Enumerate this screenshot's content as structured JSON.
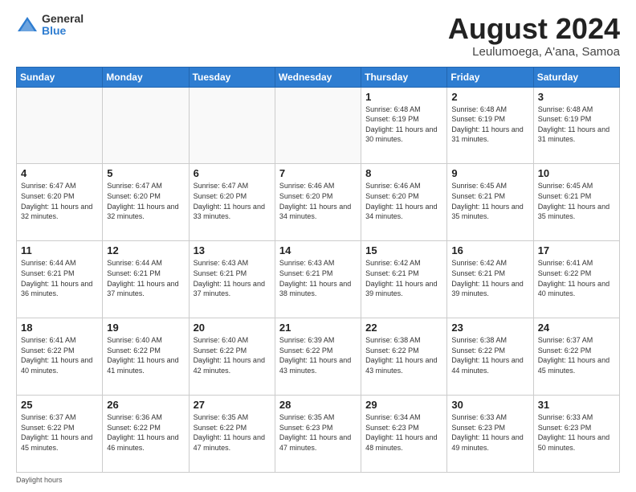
{
  "header": {
    "logo_general": "General",
    "logo_blue": "Blue",
    "title": "August 2024",
    "location": "Leulumoega, A'ana, Samoa"
  },
  "days_of_week": [
    "Sunday",
    "Monday",
    "Tuesday",
    "Wednesday",
    "Thursday",
    "Friday",
    "Saturday"
  ],
  "footer": {
    "note": "Daylight hours"
  },
  "weeks": [
    [
      {
        "day": "",
        "info": ""
      },
      {
        "day": "",
        "info": ""
      },
      {
        "day": "",
        "info": ""
      },
      {
        "day": "",
        "info": ""
      },
      {
        "day": "1",
        "info": "Sunrise: 6:48 AM\nSunset: 6:19 PM\nDaylight: 11 hours\nand 30 minutes."
      },
      {
        "day": "2",
        "info": "Sunrise: 6:48 AM\nSunset: 6:19 PM\nDaylight: 11 hours\nand 31 minutes."
      },
      {
        "day": "3",
        "info": "Sunrise: 6:48 AM\nSunset: 6:19 PM\nDaylight: 11 hours\nand 31 minutes."
      }
    ],
    [
      {
        "day": "4",
        "info": "Sunrise: 6:47 AM\nSunset: 6:20 PM\nDaylight: 11 hours\nand 32 minutes."
      },
      {
        "day": "5",
        "info": "Sunrise: 6:47 AM\nSunset: 6:20 PM\nDaylight: 11 hours\nand 32 minutes."
      },
      {
        "day": "6",
        "info": "Sunrise: 6:47 AM\nSunset: 6:20 PM\nDaylight: 11 hours\nand 33 minutes."
      },
      {
        "day": "7",
        "info": "Sunrise: 6:46 AM\nSunset: 6:20 PM\nDaylight: 11 hours\nand 34 minutes."
      },
      {
        "day": "8",
        "info": "Sunrise: 6:46 AM\nSunset: 6:20 PM\nDaylight: 11 hours\nand 34 minutes."
      },
      {
        "day": "9",
        "info": "Sunrise: 6:45 AM\nSunset: 6:21 PM\nDaylight: 11 hours\nand 35 minutes."
      },
      {
        "day": "10",
        "info": "Sunrise: 6:45 AM\nSunset: 6:21 PM\nDaylight: 11 hours\nand 35 minutes."
      }
    ],
    [
      {
        "day": "11",
        "info": "Sunrise: 6:44 AM\nSunset: 6:21 PM\nDaylight: 11 hours\nand 36 minutes."
      },
      {
        "day": "12",
        "info": "Sunrise: 6:44 AM\nSunset: 6:21 PM\nDaylight: 11 hours\nand 37 minutes."
      },
      {
        "day": "13",
        "info": "Sunrise: 6:43 AM\nSunset: 6:21 PM\nDaylight: 11 hours\nand 37 minutes."
      },
      {
        "day": "14",
        "info": "Sunrise: 6:43 AM\nSunset: 6:21 PM\nDaylight: 11 hours\nand 38 minutes."
      },
      {
        "day": "15",
        "info": "Sunrise: 6:42 AM\nSunset: 6:21 PM\nDaylight: 11 hours\nand 39 minutes."
      },
      {
        "day": "16",
        "info": "Sunrise: 6:42 AM\nSunset: 6:21 PM\nDaylight: 11 hours\nand 39 minutes."
      },
      {
        "day": "17",
        "info": "Sunrise: 6:41 AM\nSunset: 6:22 PM\nDaylight: 11 hours\nand 40 minutes."
      }
    ],
    [
      {
        "day": "18",
        "info": "Sunrise: 6:41 AM\nSunset: 6:22 PM\nDaylight: 11 hours\nand 40 minutes."
      },
      {
        "day": "19",
        "info": "Sunrise: 6:40 AM\nSunset: 6:22 PM\nDaylight: 11 hours\nand 41 minutes."
      },
      {
        "day": "20",
        "info": "Sunrise: 6:40 AM\nSunset: 6:22 PM\nDaylight: 11 hours\nand 42 minutes."
      },
      {
        "day": "21",
        "info": "Sunrise: 6:39 AM\nSunset: 6:22 PM\nDaylight: 11 hours\nand 43 minutes."
      },
      {
        "day": "22",
        "info": "Sunrise: 6:38 AM\nSunset: 6:22 PM\nDaylight: 11 hours\nand 43 minutes."
      },
      {
        "day": "23",
        "info": "Sunrise: 6:38 AM\nSunset: 6:22 PM\nDaylight: 11 hours\nand 44 minutes."
      },
      {
        "day": "24",
        "info": "Sunrise: 6:37 AM\nSunset: 6:22 PM\nDaylight: 11 hours\nand 45 minutes."
      }
    ],
    [
      {
        "day": "25",
        "info": "Sunrise: 6:37 AM\nSunset: 6:22 PM\nDaylight: 11 hours\nand 45 minutes."
      },
      {
        "day": "26",
        "info": "Sunrise: 6:36 AM\nSunset: 6:22 PM\nDaylight: 11 hours\nand 46 minutes."
      },
      {
        "day": "27",
        "info": "Sunrise: 6:35 AM\nSunset: 6:22 PM\nDaylight: 11 hours\nand 47 minutes."
      },
      {
        "day": "28",
        "info": "Sunrise: 6:35 AM\nSunset: 6:23 PM\nDaylight: 11 hours\nand 47 minutes."
      },
      {
        "day": "29",
        "info": "Sunrise: 6:34 AM\nSunset: 6:23 PM\nDaylight: 11 hours\nand 48 minutes."
      },
      {
        "day": "30",
        "info": "Sunrise: 6:33 AM\nSunset: 6:23 PM\nDaylight: 11 hours\nand 49 minutes."
      },
      {
        "day": "31",
        "info": "Sunrise: 6:33 AM\nSunset: 6:23 PM\nDaylight: 11 hours\nand 50 minutes."
      }
    ]
  ]
}
